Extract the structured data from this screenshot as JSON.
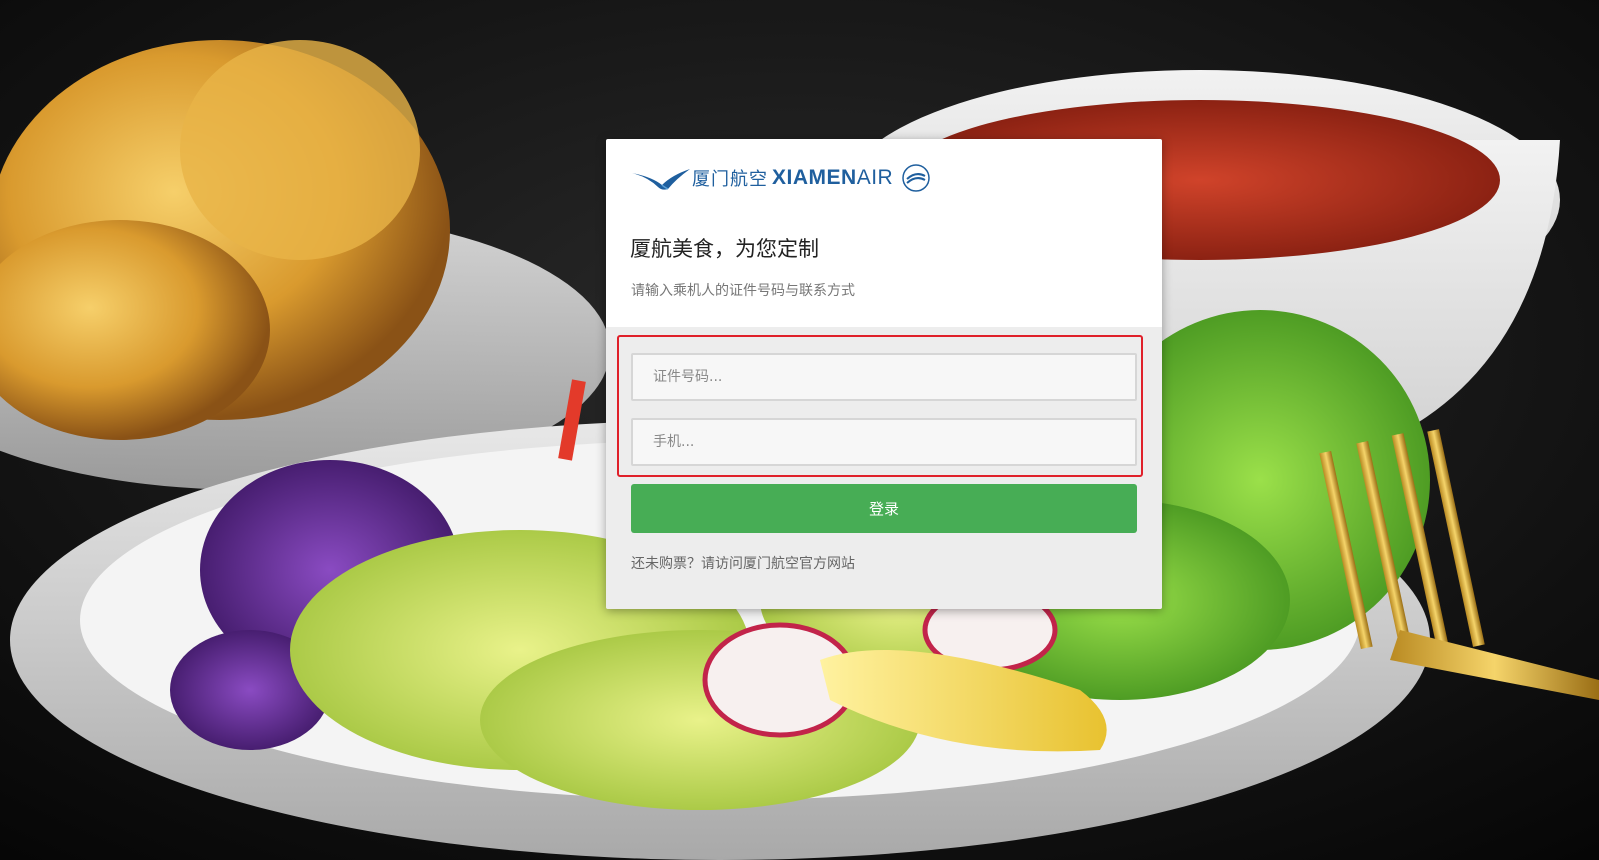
{
  "brand": {
    "name_cn": "厦门航空",
    "name_en_bold": "XIAMEN",
    "name_en_light": "AIR",
    "logo_icon": "egret-bird-icon",
    "seal_icon": "skyteam-seal-icon",
    "primary_color": "#1f5f9e"
  },
  "form": {
    "title": "厦航美食，为您定制",
    "subtitle": "请输入乘机人的证件号码与联系方式",
    "id_placeholder": "证件号码...",
    "phone_placeholder": "手机...",
    "id_value": "",
    "phone_value": "",
    "login_label": "登录",
    "login_color": "#47ad55",
    "highlight_color": "#e0202a",
    "footer_text": "还未购票？请访问厦门航空官方网站"
  }
}
